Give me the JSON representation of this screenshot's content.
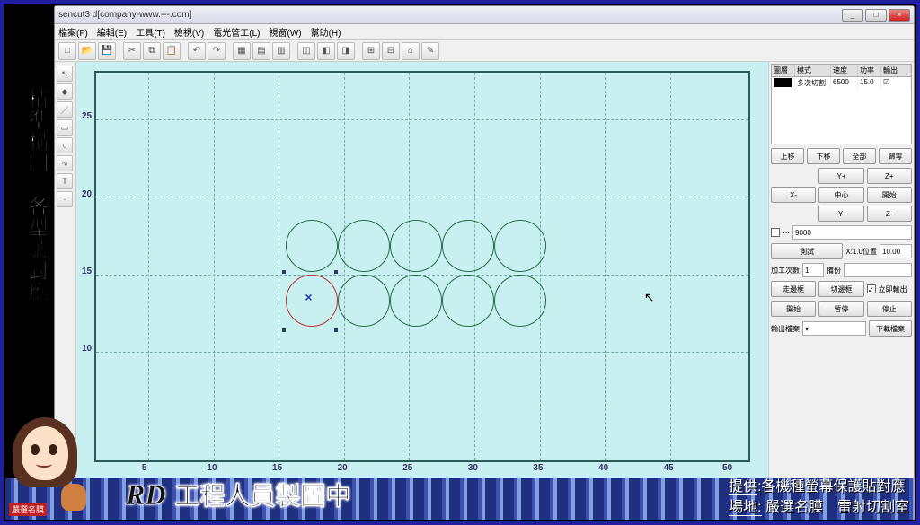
{
  "window": {
    "title": "sencut3 d[company-www.---.com]",
    "min": "_",
    "max": "□",
    "close": "×"
  },
  "menu": [
    "檔案(F)",
    "編輯(E)",
    "工具(T)",
    "檢視(V)",
    "電光管工(L)",
    "視窗(W)",
    "幫助(H)"
  ],
  "axes": {
    "y": [
      "25",
      "20",
      "15",
      "10"
    ],
    "x": [
      "5",
      "10",
      "15",
      "20",
      "25",
      "30",
      "35",
      "40",
      "45",
      "50"
    ]
  },
  "props": {
    "headers": [
      "圖層",
      "模式",
      "速度",
      "功率",
      "輸出"
    ],
    "row": {
      "layer": "",
      "mode": "多次切割",
      "speed": "6500",
      "power": "15.0",
      "out": "☑"
    }
  },
  "rp": {
    "up": "上移",
    "down": "下移",
    "fit": "全部",
    "home": "歸零",
    "yp": "Y+",
    "yn": "",
    "xn": "X-",
    "center": "中心",
    "xp": "X-",
    "ynn": "",
    "start": "開始",
    "ym": "Y-",
    "zp": "Z-",
    "gap": "9000",
    "test": "測試",
    "readpos": "X:1.0位置",
    "val": "10.00",
    "proc": "加工次數",
    "cnt": "1",
    "bk": "備份",
    "go": "走邊框",
    "cut": "切邊框",
    "check1": "立即輸出",
    "s1": "開始",
    "s2": "暫停",
    "s3": "停止",
    "output": "輸出檔案",
    "download": "下載檔案"
  },
  "anno": {
    "left": "精準構圖＼各型號對應",
    "rd": "RD",
    "rdsub": "工程人員製圖中",
    "r1a": "提供",
    "r1b": ":各機種螢幕保護貼對應",
    "r2a": "場地:",
    "r2b": "嚴選名膜　雷射切割室",
    "badge": "嚴選名膜"
  }
}
